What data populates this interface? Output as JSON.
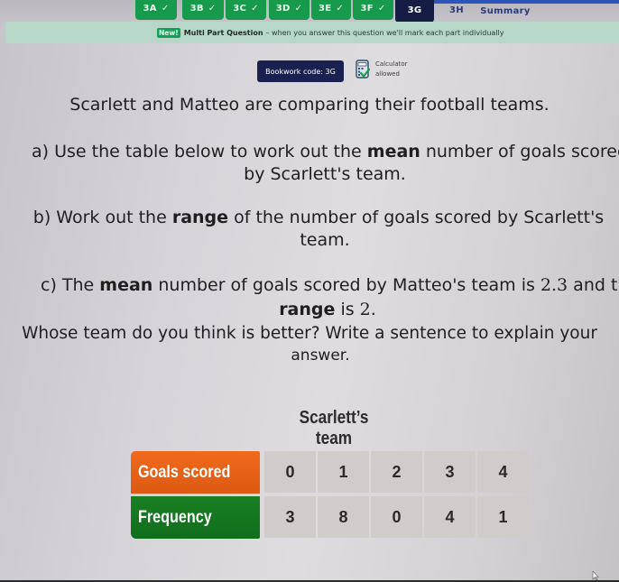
{
  "tabs": [
    {
      "label": "3A",
      "status": "done"
    },
    {
      "label": "3B",
      "status": "done"
    },
    {
      "label": "3C",
      "status": "done"
    },
    {
      "label": "3D",
      "status": "done"
    },
    {
      "label": "3E",
      "status": "done"
    },
    {
      "label": "3F",
      "status": "done"
    },
    {
      "label": "3G",
      "status": "active"
    },
    {
      "label": "3H",
      "status": "pending"
    },
    {
      "label": "Summary",
      "status": "pending"
    }
  ],
  "tick_glyph": "✓",
  "banner": {
    "badge": "New!",
    "title": "Multi Part Question",
    "description": "– when you answer this question we'll mark each part individually"
  },
  "bookwork": {
    "label": "Bookwork code: 3G"
  },
  "calculator": {
    "line1": "Calculator",
    "line2": "allowed",
    "icon": "calculator-check-icon"
  },
  "question": {
    "intro": "Scarlett and Matteo are comparing their football teams.",
    "a": {
      "prefix": "a) Use the table below to work out the ",
      "bold": "mean",
      "suffix": " number of goals scored",
      "line2": "by Scarlett's team."
    },
    "b": {
      "prefix": "b) Work out the ",
      "bold": "range",
      "suffix": " of the number of goals scored by Scarlett's",
      "line2": "team."
    },
    "c": {
      "prefix": "c) The ",
      "bold": "mean",
      "mid": " number of goals scored by Matteo's team is ",
      "mean_value": "2.3",
      "suffix": " and the",
      "line2_bold": "range",
      "line2_mid": " is ",
      "range_value": "2",
      "line2_end": ".",
      "line3": "Whose team do you think is better? Write a sentence to explain your",
      "line4": "answer."
    }
  },
  "table": {
    "title": "Scarlett’s team",
    "row_headers": [
      "Goals scored",
      "Frequency"
    ],
    "goals_scored": [
      "0",
      "1",
      "2",
      "3",
      "4"
    ],
    "frequency": [
      "3",
      "8",
      "0",
      "4",
      "1"
    ],
    "colors": {
      "goals_header": "#e8621a",
      "frequency_header": "#157a20",
      "cell": "#cfccc9"
    }
  }
}
